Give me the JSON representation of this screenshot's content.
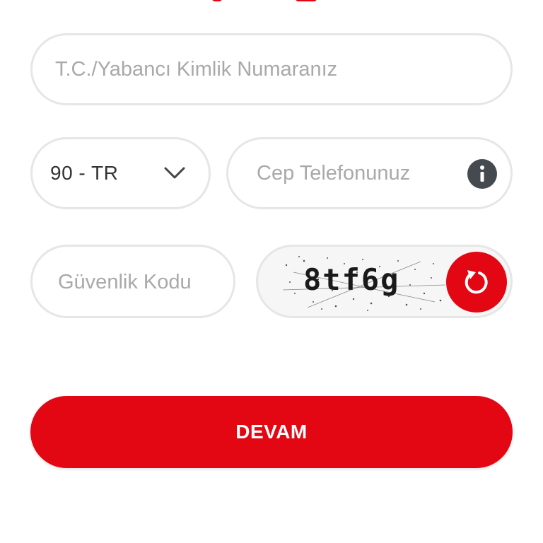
{
  "form": {
    "tc_placeholder": "T.C./Yabancı Kimlik Numaranız",
    "country_code": "90 - TR",
    "phone_placeholder": "Cep Telefonunuz",
    "security_code_placeholder": "Güvenlik Kodu",
    "captcha_text": "8tf6g",
    "submit_label": "DEVAM"
  },
  "icons": {
    "country_dropdown": "chevron-down-icon",
    "phone_info": "info-icon",
    "captcha_refresh": "refresh-icon"
  },
  "colors": {
    "brand_red": "#e30613",
    "border": "#e6e6e6",
    "placeholder": "#a9a9a9",
    "info_icon_bg": "#444a50"
  }
}
